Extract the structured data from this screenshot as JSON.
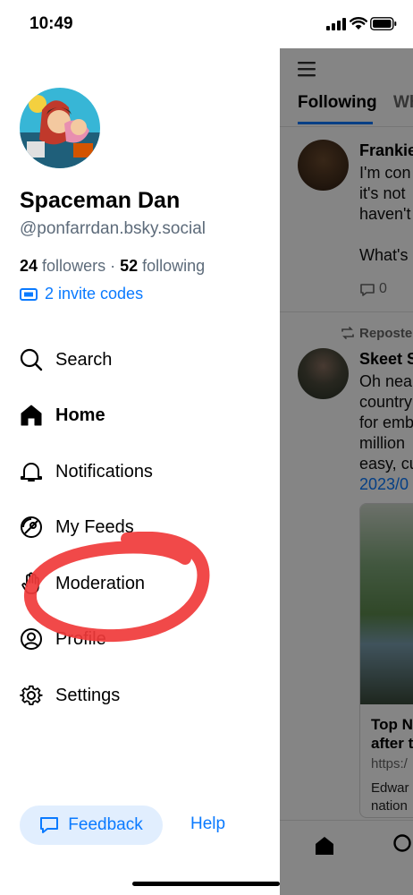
{
  "status_bar": {
    "time": "10:49"
  },
  "drawer": {
    "display_name": "Spaceman Dan",
    "handle": "@ponfarrdan.bsky.social",
    "followers_count": "24",
    "followers_label": "followers",
    "following_count": "52",
    "following_label": "following",
    "separator": "·",
    "invite_codes": "2 invite codes",
    "nav": [
      {
        "label": "Search",
        "icon": "search-icon"
      },
      {
        "label": "Home",
        "icon": "home-icon"
      },
      {
        "label": "Notifications",
        "icon": "bell-icon"
      },
      {
        "label": "My Feeds",
        "icon": "satellite-icon"
      },
      {
        "label": "Moderation",
        "icon": "hand-icon"
      },
      {
        "label": "Profile",
        "icon": "profile-icon"
      },
      {
        "label": "Settings",
        "icon": "gear-icon"
      }
    ],
    "feedback_label": "Feedback",
    "help_label": "Help"
  },
  "feed": {
    "tabs": [
      {
        "label": "Following"
      },
      {
        "label": "Wh"
      }
    ],
    "posts": [
      {
        "author": "Frankie",
        "lines": [
          "I'm con",
          "it's not",
          "haven't",
          "",
          "What's"
        ],
        "reply_count": "0"
      },
      {
        "repost_label": "Reposte",
        "author": "Skeet S",
        "lines": [
          "Oh nea",
          "country",
          "for emb",
          "million",
          "easy, cu"
        ],
        "link": "2023/0",
        "card": {
          "title_lines": [
            "Top N",
            "after t"
          ],
          "url": "https:/",
          "desc_lines": [
            "Edwar",
            "nation"
          ]
        }
      }
    ]
  },
  "colors": {
    "accent": "#0a7aff",
    "annotation": "#f03a3a",
    "feedback_bg": "#e1eefe"
  }
}
